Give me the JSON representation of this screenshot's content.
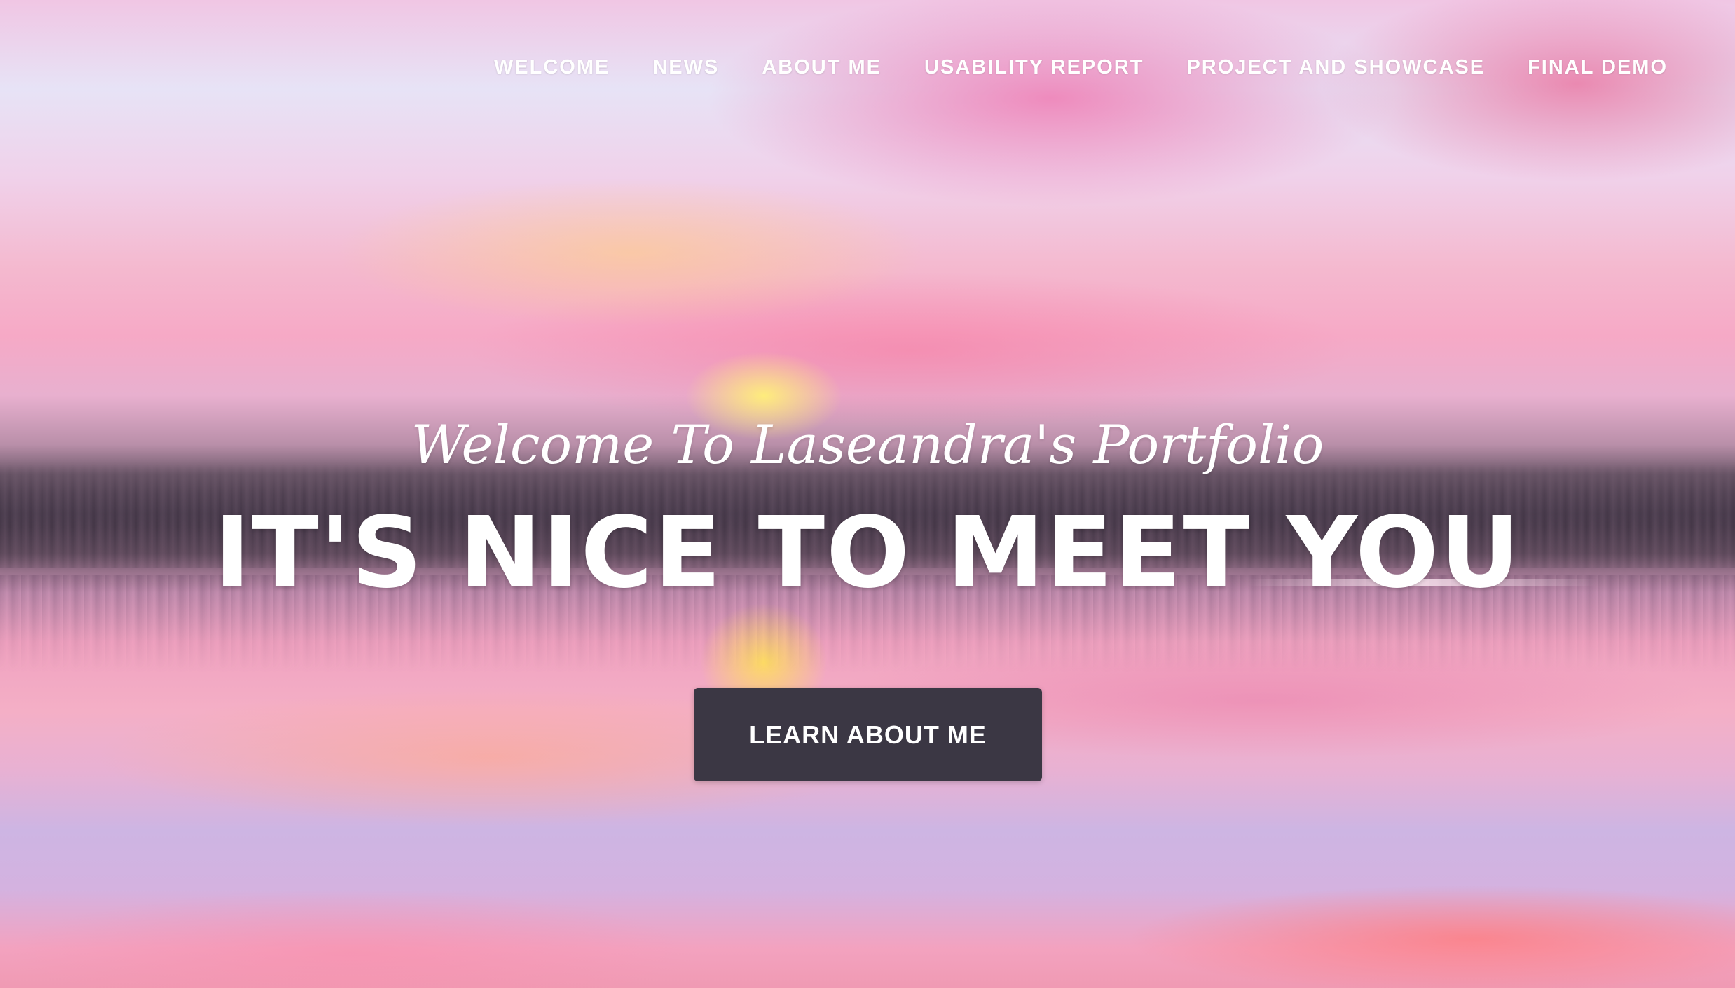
{
  "nav": {
    "items": [
      {
        "label": "WELCOME"
      },
      {
        "label": "NEWS"
      },
      {
        "label": "ABOUT ME"
      },
      {
        "label": "USABILITY REPORT"
      },
      {
        "label": "PROJECT AND SHOWCASE"
      },
      {
        "label": "FINAL DEMO"
      }
    ]
  },
  "hero": {
    "lead": "Welcome To Laseandra's Portfolio",
    "heading": "IT'S NICE TO MEET YOU",
    "cta_label": "LEARN ABOUT ME"
  },
  "colors": {
    "text": "#ffffff",
    "button_bg": "#3b3744"
  }
}
